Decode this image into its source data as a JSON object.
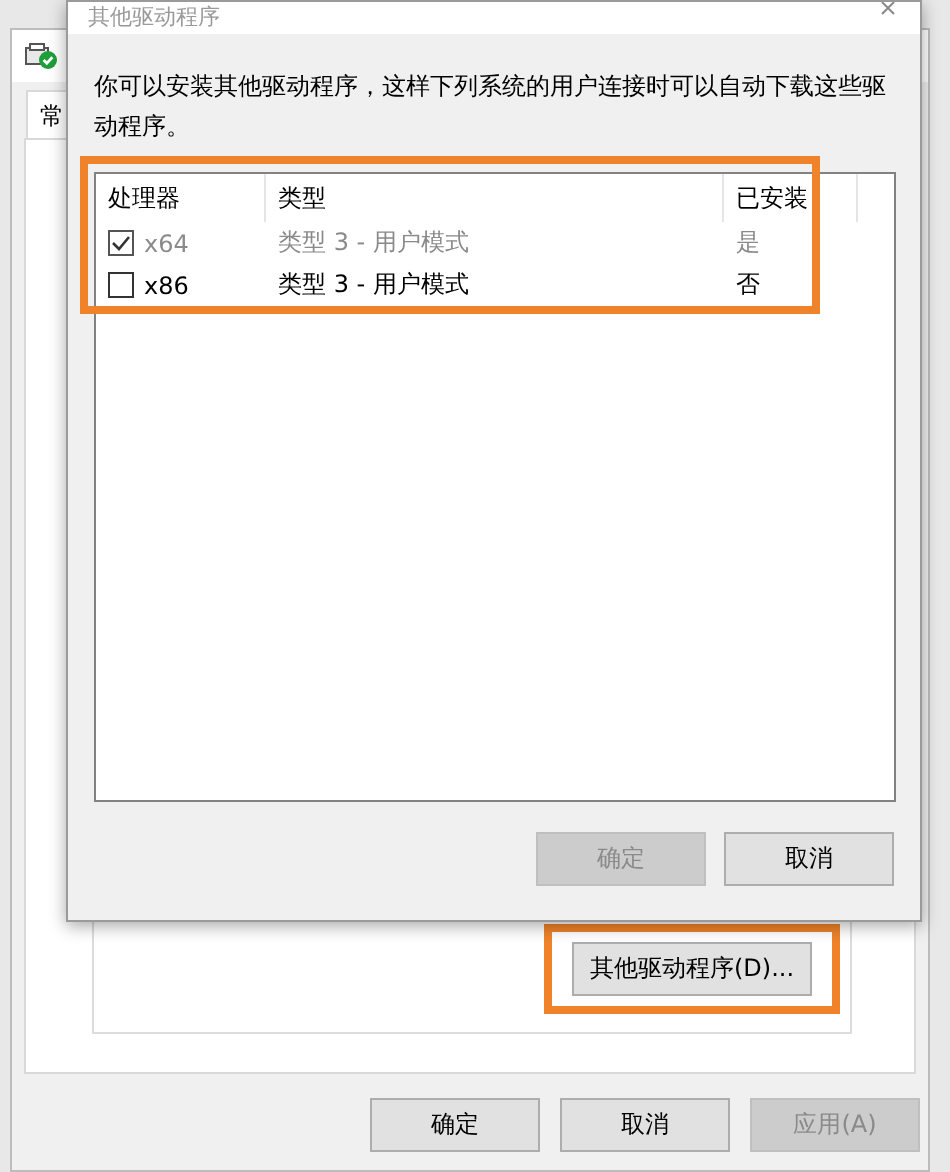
{
  "properties_window": {
    "tabs": [
      {
        "label": "常",
        "selected": true
      }
    ],
    "drivers_button": {
      "label": "其他驱动程序(D)...",
      "highlighted": true
    },
    "buttons": [
      {
        "label": "确定",
        "disabled": false
      },
      {
        "label": "取消",
        "disabled": false
      },
      {
        "label": "应用(A)",
        "disabled": true
      }
    ]
  },
  "dialog": {
    "title": "其他驱动程序",
    "description": "你可以安装其他驱动程序，这样下列系统的用户连接时可以自动下载这些驱动程序。",
    "list": {
      "highlighted": true,
      "columns": [
        "处理器",
        "类型",
        "已安装"
      ],
      "rows": [
        {
          "processor": "x64",
          "type": "类型 3 - 用户模式",
          "installed": "是",
          "checked": true,
          "disabled": true
        },
        {
          "processor": "x86",
          "type": "类型 3 - 用户模式",
          "installed": "否",
          "checked": false,
          "disabled": false
        }
      ]
    },
    "buttons": [
      {
        "label": "确定",
        "disabled": true
      },
      {
        "label": "取消",
        "disabled": false
      }
    ]
  }
}
